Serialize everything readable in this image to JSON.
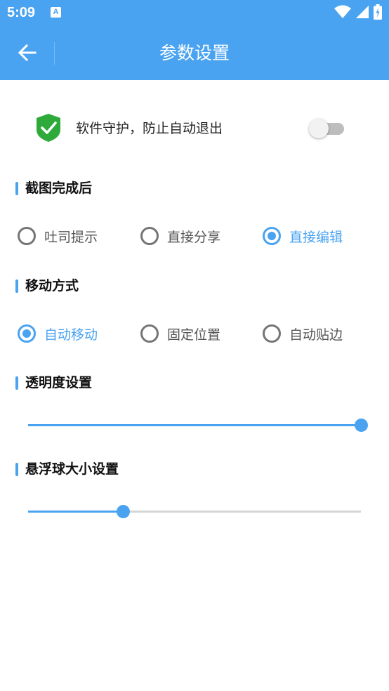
{
  "status_bar": {
    "time": "5:09",
    "notification_badge": "A"
  },
  "header": {
    "title": "参数设置",
    "back_icon": "arrow-left-icon"
  },
  "guard": {
    "label": "软件守护，防止自动退出",
    "enabled": false,
    "icon": "shield-check-icon"
  },
  "screenshot_section": {
    "title": "截图完成后",
    "options": [
      {
        "label": "吐司提示",
        "checked": false
      },
      {
        "label": "直接分享",
        "checked": false
      },
      {
        "label": "直接编辑",
        "checked": true
      }
    ]
  },
  "move_section": {
    "title": "移动方式",
    "options": [
      {
        "label": "自动移动",
        "checked": true
      },
      {
        "label": "固定位置",
        "checked": false
      },
      {
        "label": "自动贴边",
        "checked": false
      }
    ]
  },
  "opacity_section": {
    "title": "透明度设置",
    "value_fraction": 1.0
  },
  "ball_size_section": {
    "title": "悬浮球大小设置",
    "value_fraction": 0.285
  },
  "colors": {
    "accent": "#4aa3f0",
    "shield_green": "#2eaa3a",
    "switch_off": "#bdbdbd"
  }
}
